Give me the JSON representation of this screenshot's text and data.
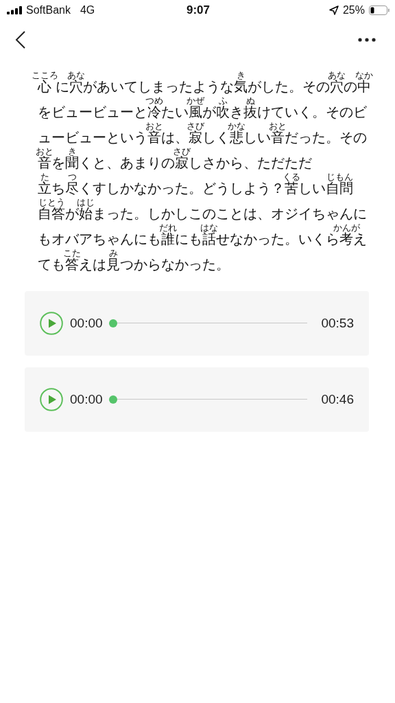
{
  "status_bar": {
    "carrier": "SoftBank",
    "network": "4G",
    "time": "9:07",
    "battery": "25%"
  },
  "passage": {
    "lines": [
      [
        {
          "text": "心",
          "ruby": "こころ"
        },
        {
          "text": " に"
        },
        {
          "text": "穴",
          "ruby": "あな"
        },
        {
          "text": "があいてしまったような"
        },
        {
          "text": "気",
          "ruby": "き"
        },
        {
          "text": "がした。その"
        },
        {
          "text": "穴",
          "ruby": "あな"
        },
        {
          "text": "の"
        },
        {
          "text": "中",
          "ruby": "なか"
        }
      ],
      [
        {
          "text": "をビュービューと"
        },
        {
          "text": "冷",
          "ruby": "つめ"
        },
        {
          "text": "たい"
        },
        {
          "text": "風",
          "ruby": "かぜ"
        },
        {
          "text": "が"
        },
        {
          "text": "吹",
          "ruby": "ふ"
        },
        {
          "text": "き"
        },
        {
          "text": "抜",
          "ruby": "ぬ"
        },
        {
          "text": "けていく。そのビ"
        }
      ],
      [
        {
          "text": "ュービューという"
        },
        {
          "text": "音",
          "ruby": "おと"
        },
        {
          "text": "は、"
        },
        {
          "text": "寂",
          "ruby": "さび"
        },
        {
          "text": "しく"
        },
        {
          "text": "悲",
          "ruby": "かな"
        },
        {
          "text": "しい"
        },
        {
          "text": "音",
          "ruby": "おと"
        },
        {
          "text": "だった。その"
        }
      ],
      [
        {
          "text": "音",
          "ruby": "おと"
        },
        {
          "text": "を"
        },
        {
          "text": "聞",
          "ruby": "き"
        },
        {
          "text": "くと、あまりの"
        },
        {
          "text": "寂",
          "ruby": "さび"
        },
        {
          "text": "しさから、ただただ"
        }
      ],
      [
        {
          "text": "立",
          "ruby": "た"
        },
        {
          "text": "ち"
        },
        {
          "text": "尽",
          "ruby": "つ"
        },
        {
          "text": "くすしかなかった。どうしよう？"
        },
        {
          "text": "苦",
          "ruby": "くる"
        },
        {
          "text": "しい"
        },
        {
          "text": "自問",
          "ruby": "じもん"
        }
      ],
      [
        {
          "text": "自答",
          "ruby": "じとう"
        },
        {
          "text": "が"
        },
        {
          "text": "始",
          "ruby": "はじ"
        },
        {
          "text": "まった。しかしこのことは、オジイちゃんに"
        }
      ],
      [
        {
          "text": "もオバアちゃんにも"
        },
        {
          "text": "誰",
          "ruby": "だれ"
        },
        {
          "text": "にも"
        },
        {
          "text": "話",
          "ruby": "はな"
        },
        {
          "text": "せなかった。いくら"
        },
        {
          "text": "考",
          "ruby": "かんが"
        },
        {
          "text": "え"
        }
      ],
      [
        {
          "text": "ても"
        },
        {
          "text": "答",
          "ruby": "こた"
        },
        {
          "text": "えは"
        },
        {
          "text": "見",
          "ruby": "み"
        },
        {
          "text": "つからなかった。"
        }
      ]
    ]
  },
  "players": [
    {
      "current": "00:00",
      "duration": "00:53",
      "level": 0
    },
    {
      "current": "00:00",
      "duration": "00:46",
      "level": 0
    }
  ]
}
